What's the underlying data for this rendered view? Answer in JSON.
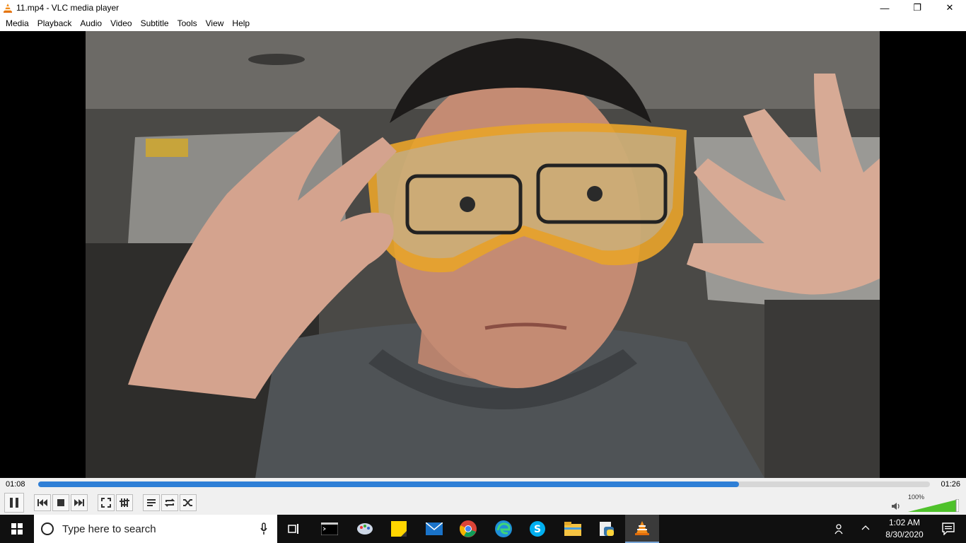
{
  "window": {
    "title": "11.mp4 - VLC media player",
    "minimize_glyph": "—",
    "restore_glyph": "❐",
    "close_glyph": "✕"
  },
  "menu": [
    "Media",
    "Playback",
    "Audio",
    "Video",
    "Subtitle",
    "Tools",
    "View",
    "Help"
  ],
  "player": {
    "elapsed": "01:08",
    "total": "01:26",
    "progress": 0.786,
    "volume_label": "100%",
    "volume": 1.0,
    "accent": "#2f7fd6"
  },
  "controls": [
    "pause-icon",
    "previous-icon",
    "stop-icon",
    "next-icon",
    "fullscreen-icon",
    "extended-settings-icon",
    "playlist-icon",
    "loop-icon",
    "shuffle-icon"
  ],
  "taskbar": {
    "search_placeholder": "Type here to search",
    "time": "1:02 AM",
    "date": "8/30/2020",
    "apps": [
      "task-view-icon",
      "terminal-icon",
      "paint-icon",
      "sticky-notes-icon",
      "mail-icon",
      "chrome-icon",
      "edge-icon",
      "skype-icon",
      "file-explorer-icon",
      "python-icon",
      "vlc-icon"
    ]
  }
}
